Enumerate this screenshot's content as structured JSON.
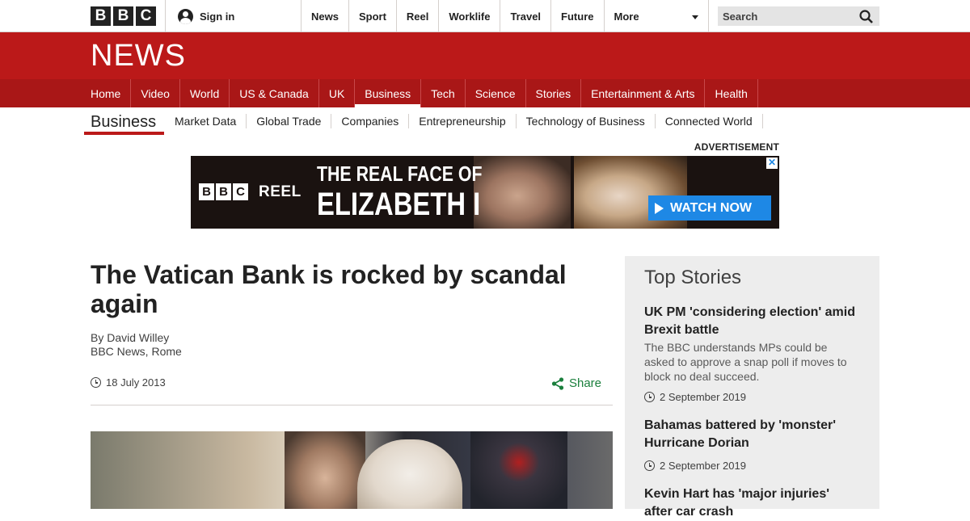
{
  "topbar": {
    "logo_letters": [
      "B",
      "B",
      "C"
    ],
    "sign_in": "Sign in",
    "nav": [
      "News",
      "Sport",
      "Reel",
      "Worklife",
      "Travel",
      "Future"
    ],
    "more": "More",
    "search_placeholder": "Search"
  },
  "masthead": {
    "title": "NEWS"
  },
  "main_nav": [
    "Home",
    "Video",
    "World",
    "US & Canada",
    "UK",
    "Business",
    "Tech",
    "Science",
    "Stories",
    "Entertainment & Arts",
    "Health"
  ],
  "main_nav_active": "Business",
  "section_nav": {
    "title": "Business",
    "items": [
      "Market Data",
      "Global Trade",
      "Companies",
      "Entrepreneurship",
      "Technology of Business",
      "Connected World"
    ]
  },
  "ad": {
    "label": "ADVERTISEMENT",
    "brand_letters": [
      "B",
      "B",
      "C"
    ],
    "brand_word": "REEL",
    "headline_line1": "THE REAL FACE OF",
    "headline_line2": "ELIZABETH I",
    "cta": "WATCH NOW",
    "close": "✕",
    "cta_color": "#1e88e5"
  },
  "article": {
    "headline": "The Vatican Bank is rocked by scandal again",
    "author": "By David Willey",
    "location": "BBC News, Rome",
    "date": "18 July 2013",
    "share": "Share",
    "share_color": "#1a7f3c"
  },
  "sidebar": {
    "title": "Top Stories",
    "stories": [
      {
        "title": "UK PM 'considering election' amid Brexit battle",
        "summary": "The BBC understands MPs could be asked to approve a snap poll if moves to block no deal succeed.",
        "date": "2 September 2019"
      },
      {
        "title": "Bahamas battered by 'monster' Hurricane Dorian",
        "summary": "",
        "date": "2 September 2019"
      },
      {
        "title": "Kevin Hart has 'major injuries' after car crash",
        "summary": "",
        "date": ""
      }
    ]
  },
  "colors": {
    "brand_red": "#bb1919",
    "nav_red": "#a91717"
  }
}
